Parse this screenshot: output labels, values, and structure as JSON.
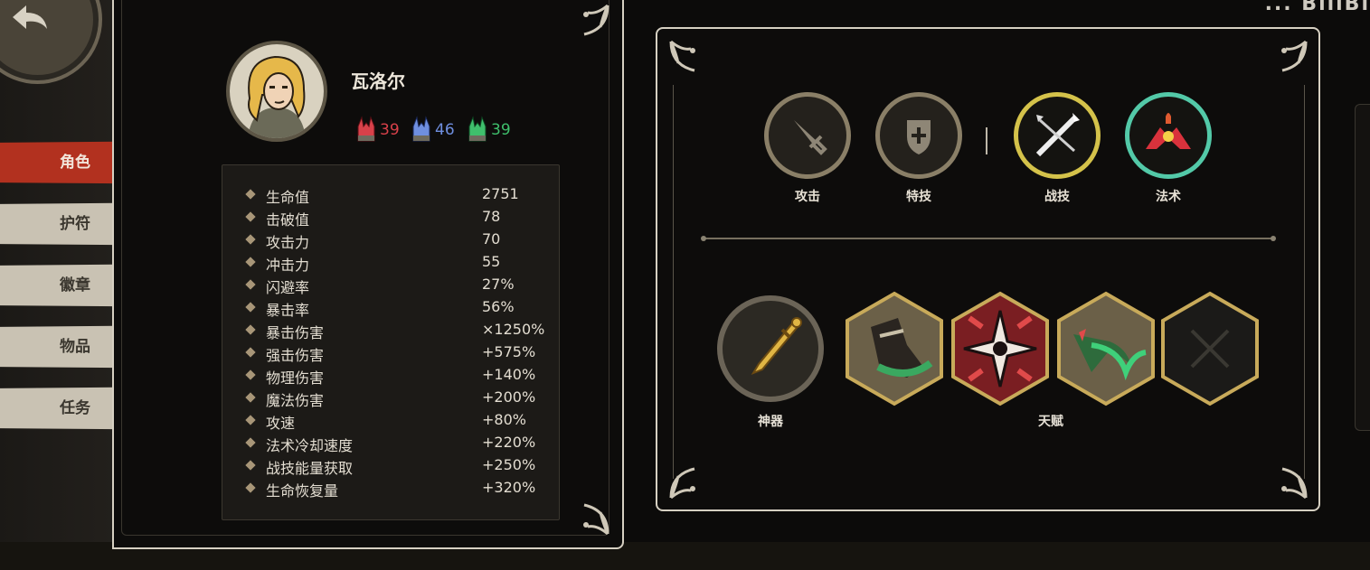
{
  "header": {
    "partial_text": "...  BiliBi"
  },
  "tabs": [
    {
      "label": "角色",
      "active": true
    },
    {
      "label": "护符",
      "active": false
    },
    {
      "label": "徽章",
      "active": false
    },
    {
      "label": "物品",
      "active": false
    },
    {
      "label": "任务",
      "active": false
    }
  ],
  "character": {
    "name": "瓦洛尔",
    "resistances": [
      {
        "icon": "red-resist-icon",
        "value": "39",
        "color": "#d8414a"
      },
      {
        "icon": "blue-resist-icon",
        "value": "46",
        "color": "#6f8fe0"
      },
      {
        "icon": "green-resist-icon",
        "value": "39",
        "color": "#3fbf6c"
      }
    ]
  },
  "stats": [
    {
      "label": "生命值",
      "value": "2751"
    },
    {
      "label": "击破值",
      "value": "78"
    },
    {
      "label": "攻击力",
      "value": "70"
    },
    {
      "label": "冲击力",
      "value": "55"
    },
    {
      "label": "闪避率",
      "value": "27%"
    },
    {
      "label": "暴击率",
      "value": "56%"
    },
    {
      "label": "暴击伤害",
      "value": "×1250%"
    },
    {
      "label": "强击伤害",
      "value": "+575%"
    },
    {
      "label": "物理伤害",
      "value": "+140%"
    },
    {
      "label": "魔法伤害",
      "value": "+200%"
    },
    {
      "label": "攻速",
      "value": "+80%"
    },
    {
      "label": "法术冷却速度",
      "value": "+220%"
    },
    {
      "label": "战技能量获取",
      "value": "+250%"
    },
    {
      "label": "生命恢复量",
      "value": "+320%"
    }
  ],
  "skills": [
    {
      "label": "攻击",
      "icon": "sword-icon",
      "ring_color": "#8a7f67"
    },
    {
      "label": "特技",
      "icon": "shield-cross-icon",
      "ring_color": "#8a7f67"
    },
    {
      "label": "战技",
      "icon": "crossed-blades-icon",
      "ring_color": "#d4c24a"
    },
    {
      "label": "法术",
      "icon": "red-flame-sigil-icon",
      "ring_color": "#53c9a8"
    }
  ],
  "artifact": {
    "label": "神器",
    "icon": "dagger-icon"
  },
  "talents": {
    "label": "天赋",
    "slots": [
      {
        "icon": "boot-kick-icon",
        "empty": false
      },
      {
        "icon": "shuriken-star-icon",
        "empty": false
      },
      {
        "icon": "green-arrow-icon",
        "empty": false
      },
      {
        "icon": "empty-slot-icon",
        "empty": true
      }
    ]
  }
}
